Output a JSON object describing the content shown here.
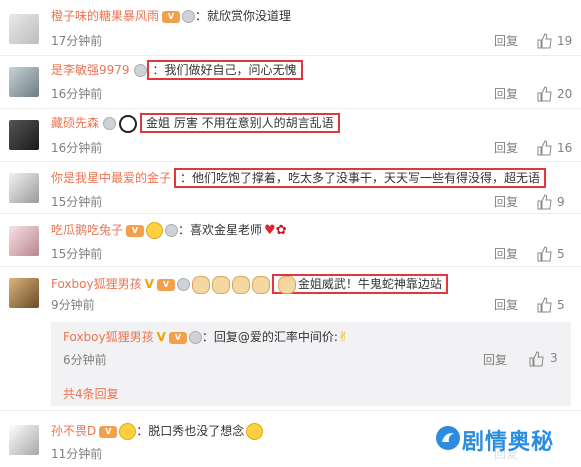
{
  "comments": [
    {
      "user": "橙子味的糖果暴风雨",
      "text": "：就欣赏你没道理",
      "time": "17分钟前",
      "reply": "回复",
      "likes": "19"
    },
    {
      "user": "是李敏强9979",
      "text": "：我们做好自己，问心无愧",
      "time": "16分钟前",
      "reply": "回复",
      "likes": "20"
    },
    {
      "user": "藏硕先森",
      "text": "金姐 厉害 不用在意别人的胡言乱语",
      "time": "16分钟前",
      "reply": "回复",
      "likes": "16"
    },
    {
      "user": "你是我星中最爱的金子",
      "text": "：他们吃饱了撑着，吃太多了没事干，天天写一些有得没得，超无语",
      "time": "15分钟前",
      "reply": "回复",
      "likes": "9"
    },
    {
      "user": "吃瓜鹅吃兔子",
      "text": "：喜欢金星老师",
      "time": "15分钟前",
      "reply": "回复",
      "likes": "5"
    },
    {
      "user": "Foxboy狐狸男孩",
      "text": "金姐威武！牛鬼蛇神靠边站",
      "time": "9分钟前",
      "reply": "回复",
      "likes": "5"
    }
  ],
  "subreply": {
    "user": "Foxboy狐狸男孩",
    "text": "：回复@爱的汇率中间价:",
    "time": "6分钟前",
    "reply": "回复",
    "likes": "3",
    "more": "共4条回复"
  },
  "last": {
    "user": "孙不畏D",
    "text": "：脱口秀也没了想念",
    "time": "11分钟前",
    "reply": "回复"
  },
  "watermark": "剧情奥秘",
  "colors": {
    "username": "#eb7350",
    "highlight": "#e0373d",
    "meta": "#808080",
    "subbg": "#f2f2f5"
  }
}
